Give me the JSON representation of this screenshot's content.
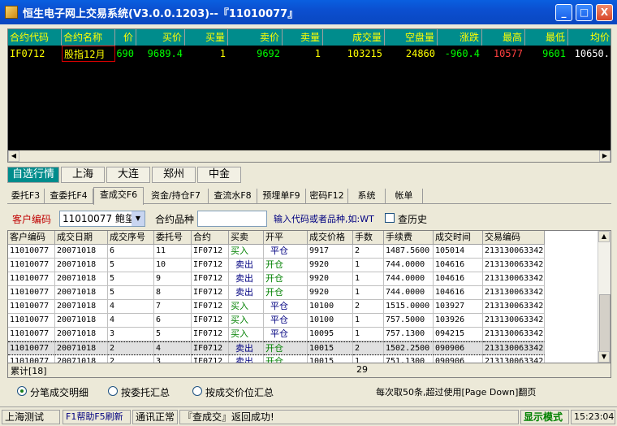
{
  "window": {
    "title": "恒生电子网上交易系统(V3.0.0.1203)--『11010077』",
    "min_label": "_",
    "max_label": "□",
    "close_label": "X"
  },
  "quote": {
    "columns": [
      "合约代码",
      "合约名称",
      "价",
      "买价",
      "买量",
      "卖价",
      "卖量",
      "成交量",
      "空盘量",
      "涨跌",
      "最高",
      "最低",
      "均价"
    ],
    "row": [
      "IF0712",
      "股指12月",
      "690",
      "9689.4",
      "1",
      "9692",
      "1",
      "103215",
      "24860",
      "-960.4",
      "10577",
      "9601",
      "10650."
    ]
  },
  "market_tabs": [
    "自选行情",
    "上海",
    "大连",
    "郑州",
    "中金"
  ],
  "func_tabs": [
    "委托F3",
    "查委托F4",
    "查成交F6",
    "资金/持仓F7",
    "查流水F8",
    "预埋单F9",
    "密码F12",
    "系统",
    "帐单"
  ],
  "client": {
    "label": "客户编码",
    "value": "11010077 鲍玺",
    "contract_label": "合约品种",
    "contract_value": "",
    "hint": "输入代码或者品种,如:WT",
    "history_label": "查历史"
  },
  "trades": {
    "columns": [
      "客户编码",
      "成交日期",
      "成交序号",
      "委托号",
      "合约",
      "买卖",
      "开平",
      "成交价格",
      "手数",
      "手续费",
      "成交时间",
      "交易编码"
    ],
    "rows": [
      [
        "11010077",
        "20071018",
        "6",
        "11",
        "IF0712",
        "买入",
        "平仓",
        "9917",
        "2",
        "1487.5600",
        "105014",
        "213130063342"
      ],
      [
        "11010077",
        "20071018",
        "5",
        "10",
        "IF0712",
        "卖出",
        "开仓",
        "9920",
        "1",
        "744.0000",
        "104616",
        "213130063342"
      ],
      [
        "11010077",
        "20071018",
        "5",
        "9",
        "IF0712",
        "卖出",
        "开仓",
        "9920",
        "1",
        "744.0000",
        "104616",
        "213130063342"
      ],
      [
        "11010077",
        "20071018",
        "5",
        "8",
        "IF0712",
        "卖出",
        "开仓",
        "9920",
        "1",
        "744.0000",
        "104616",
        "213130063342"
      ],
      [
        "11010077",
        "20071018",
        "4",
        "7",
        "IF0712",
        "买入",
        "平仓",
        "10100",
        "2",
        "1515.0000",
        "103927",
        "213130063342"
      ],
      [
        "11010077",
        "20071018",
        "4",
        "6",
        "IF0712",
        "买入",
        "平仓",
        "10100",
        "1",
        "757.5000",
        "103926",
        "213130063342"
      ],
      [
        "11010077",
        "20071018",
        "3",
        "5",
        "IF0712",
        "买入",
        "平仓",
        "10095",
        "1",
        "757.1300",
        "094215",
        "213130063342"
      ],
      [
        "11010077",
        "20071018",
        "2",
        "4",
        "IF0712",
        "卖出",
        "开仓",
        "10015",
        "2",
        "1502.2500",
        "090906",
        "213130063342"
      ],
      [
        "11010077",
        "20071018",
        "2",
        "3",
        "IF0712",
        "卖出",
        "开仓",
        "10015",
        "1",
        "751.1300",
        "090906",
        "213130063342"
      ]
    ],
    "selected_row": 7,
    "total_label": "累计[18]",
    "total_qty": "29"
  },
  "options": {
    "radio1": "分笔成交明细",
    "radio2": "按委托汇总",
    "radio3": "按成交价位汇总",
    "paging_note": "每次取50条,超过使用[Page Down]翻页"
  },
  "status": {
    "exchange": "上海测试",
    "help": "F1帮助F5刷新",
    "comm": "通讯正常",
    "message": "『查成交』返回成功!",
    "mode": "显示模式",
    "time": "15:23:04"
  },
  "colors": {
    "quote_header_bg": "#008c8c",
    "quote_header_text": "#ffff00",
    "up_text": "#ff4040",
    "down_text": "#00ff00",
    "code_text": "#ffff00",
    "buy_text": "#008000",
    "sell_text": "#000080"
  }
}
